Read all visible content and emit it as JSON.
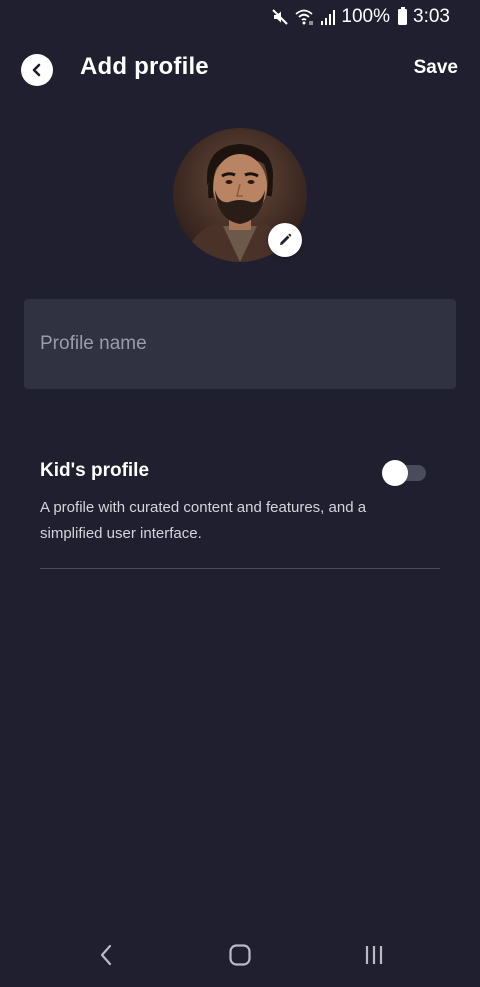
{
  "status_bar": {
    "battery": "100%",
    "time": "3:03",
    "icons": [
      "mute-icon",
      "wifi-icon",
      "signal-icon",
      "battery-icon"
    ]
  },
  "header": {
    "title": "Add profile",
    "save_label": "Save",
    "back_icon": "chevron-left-icon"
  },
  "avatar": {
    "edit_icon": "pencil-icon"
  },
  "profile_name": {
    "placeholder": "Profile name",
    "value": ""
  },
  "kids_profile": {
    "title": "Kid's profile",
    "description": "A profile with curated content and features, and a simplified user interface.",
    "enabled": false
  },
  "nav_bar": {
    "icons": [
      "back-icon",
      "home-icon",
      "recents-icon"
    ]
  },
  "colors": {
    "background": "#1f1f2f",
    "field": "#303241",
    "text_primary": "#ffffff",
    "text_secondary": "#d4d5db",
    "placeholder": "#9a9ca8",
    "toggle_track": "#4a4c5a"
  }
}
